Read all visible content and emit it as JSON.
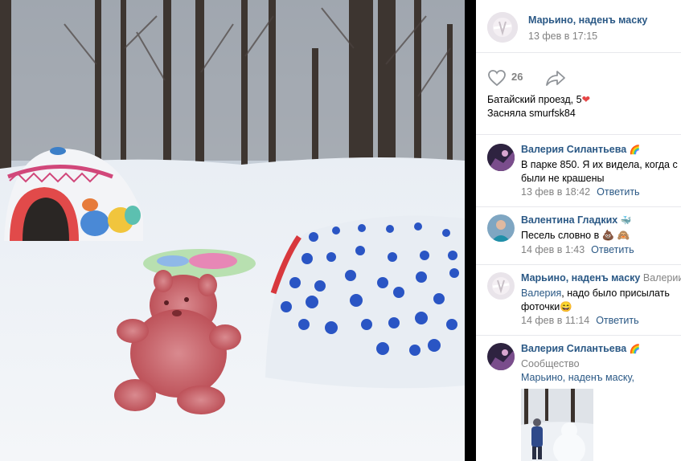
{
  "post": {
    "author": "Марьино, наденъ маску",
    "date": "13 фев в 17:15",
    "likes": "26",
    "text_line1": "Батайский проезд, 5",
    "text_line1_emoji": "❤",
    "text_line2": "Засняла smurfsk84"
  },
  "comments": [
    {
      "author": "Валерия Силантьева",
      "author_emoji": "🌈",
      "text_line1": "В парке 850. Я их видела, когда с",
      "text_line2": "были не крашены",
      "date": "13 фев в 18:42",
      "reply_label": "Ответить"
    },
    {
      "author": "Валентина Гладких",
      "author_emoji": "🐳",
      "text_line1": "Песель словно в ",
      "text_emoji": "💩 🙈",
      "date": "14 фев в 1:43",
      "reply_label": "Ответить"
    },
    {
      "author": "Марьино, наденъ маску",
      "reply_to": "Валерии",
      "text_line1_link": "Валерия",
      "text_line1": ", надо было присылать",
      "text_line2": "фоточки",
      "text_emoji": "😄",
      "date": "14 фев в 11:14",
      "reply_label": "Ответить"
    },
    {
      "author": "Валерия Силантьева",
      "author_emoji": "🌈",
      "text_line1": "Сообщество",
      "text_line2_link": "Марьино, наденъ маску,"
    }
  ],
  "icons": {
    "like": "heart-outline-icon",
    "share": "share-arrow-icon"
  },
  "colors": {
    "link": "#2a5885",
    "meta": "#828282",
    "background": "#000000"
  }
}
